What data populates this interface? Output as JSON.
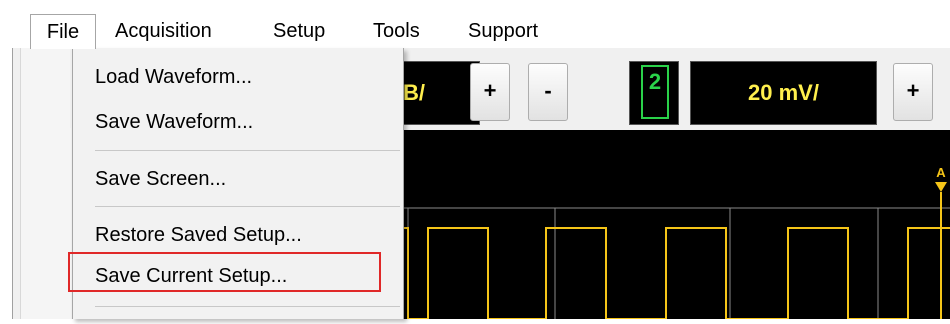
{
  "menubar": {
    "items": [
      {
        "label": "File"
      },
      {
        "label": "Acquisition"
      },
      {
        "label": "Setup"
      },
      {
        "label": "Tools"
      },
      {
        "label": "Support"
      }
    ]
  },
  "file_menu": {
    "items": [
      {
        "label": "Load Waveform..."
      },
      {
        "label": "Save Waveform..."
      },
      {
        "label": "Save Screen..."
      },
      {
        "label": "Restore Saved Setup..."
      },
      {
        "label": "Save Current Setup..."
      }
    ],
    "highlighted_item": "Save Current Setup..."
  },
  "toolbar": {
    "timebase_partial": "B/",
    "plus_label": "+",
    "minus_label": "-",
    "channel_number": "2",
    "vertical_scale": "20 mV/",
    "plus2_label": "+"
  },
  "scope": {
    "trigger_marker": "A",
    "trace_color": "#f5c518",
    "grid_color": "#8a8a8a"
  },
  "colors": {
    "lcd_text": "#ffef4d",
    "channel_green": "#2ad24a",
    "highlight_red": "#e02828"
  }
}
